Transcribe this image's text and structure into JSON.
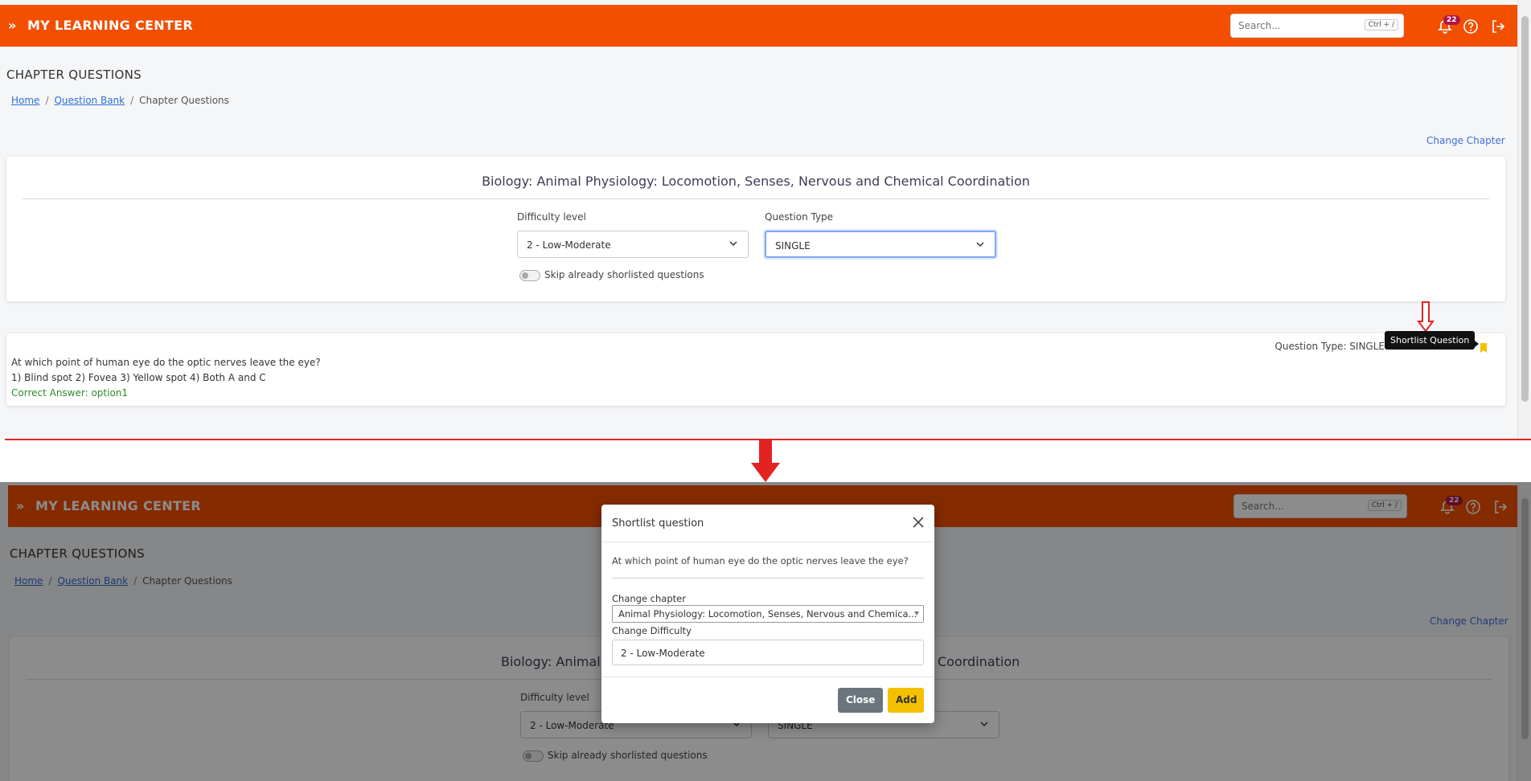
{
  "app": {
    "brand": "MY LEARNING CENTER",
    "search_placeholder": "Search...",
    "search_shortcut": "Ctrl + /",
    "notification_count": "22"
  },
  "page": {
    "title": "CHAPTER QUESTIONS",
    "breadcrumb": {
      "home": "Home",
      "question_bank": "Question Bank",
      "current": "Chapter Questions"
    },
    "change_chapter": "Change Chapter"
  },
  "filters": {
    "chapter_title": "Biology: Animal Physiology: Locomotion, Senses, Nervous and Chemical Coordination",
    "difficulty_label": "Difficulty level",
    "difficulty_value": "2 - Low-Moderate",
    "question_type_label": "Question Type",
    "question_type_value": "SINGLE",
    "skip_label": "Skip already shorlisted questions"
  },
  "question": {
    "type_text": "Question Type: SINGLE",
    "text": "At which point of human eye do the optic nerves leave the eye?",
    "options": "1) Blind spot 2) Fovea 3) Yellow spot 4) Both A and C",
    "answer": "Correct Answer: option1",
    "tooltip": "Shortlist Question"
  },
  "bottom_partial": {
    "chapter_left": "Biology: Animal P",
    "chapter_right": "Coordination"
  },
  "modal": {
    "title": "Shortlist question",
    "question": "At which point of human eye do the optic nerves leave the eye?",
    "change_chapter_label": "Change chapter",
    "change_chapter_value": "Animal Physiology: Locomotion, Senses, Nervous and Chemica...",
    "change_difficulty_label": "Change Difficulty",
    "change_difficulty_value": "2 - Low-Moderate",
    "close_label": "Close",
    "add_label": "Add"
  },
  "colors": {
    "brand_orange": "#f24f00",
    "accent_yellow": "#f5c000",
    "arrow_red": "#e32222"
  }
}
